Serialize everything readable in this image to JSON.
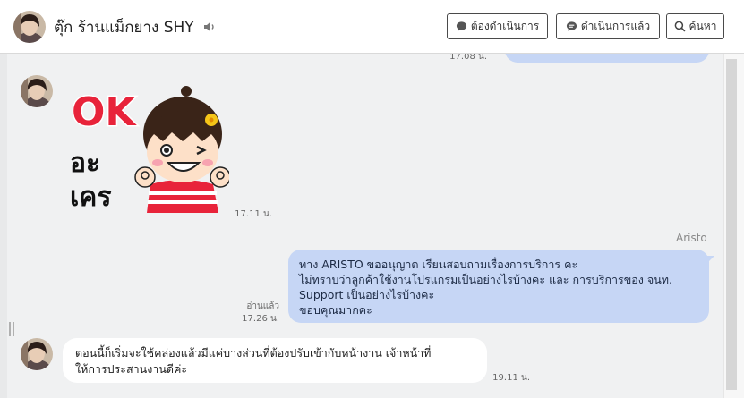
{
  "header": {
    "contact_name": "ตุ๊ก ร้านแม็กยาง SHY",
    "buttons": {
      "todo": "ต้องดำเนินการ",
      "done": "ดำเนินการแล้ว",
      "search": "ค้นหา"
    }
  },
  "messages": [
    {
      "id": "m0",
      "direction": "outgoing",
      "time": "17.08 น.",
      "text": ""
    },
    {
      "id": "m1",
      "direction": "incoming",
      "type": "sticker",
      "sticker_text_top": "OK",
      "sticker_text_bottom": [
        "อะ",
        "เคร"
      ],
      "time": "17.11 น."
    },
    {
      "id": "m2",
      "direction": "outgoing",
      "sender": "Aristo",
      "read_label": "อ่านแล้ว",
      "time": "17.26 น.",
      "lines": [
        "ทาง ARISTO ขออนุญาต เรียนสอบถามเรื่องการบริการ คะ",
        "ไม่ทราบว่าลูกค้าใช้งานโปรแกรมเป็นอย่างไรบ้างคะ และ การบริการของ จนท.",
        "Support เป็นอย่างไรบ้างคะ",
        "ขอบคุณมากคะ"
      ]
    },
    {
      "id": "m3",
      "direction": "incoming",
      "time": "19.11 น.",
      "lines": [
        "ตอนนี้ก็เริ่มจะใช้คล่องแล้วมีแค่บางส่วนที่ต้องปรับเข้ากับหน้างาน เจ้าหน้าที่",
        "ให้การประสานงานดีค่ะ"
      ]
    }
  ],
  "colors": {
    "outgoing_bubble": "#c6d6f5",
    "incoming_bubble": "#ffffff",
    "chat_background": "#f0f1f2",
    "sticker_red": "#e8233a"
  }
}
